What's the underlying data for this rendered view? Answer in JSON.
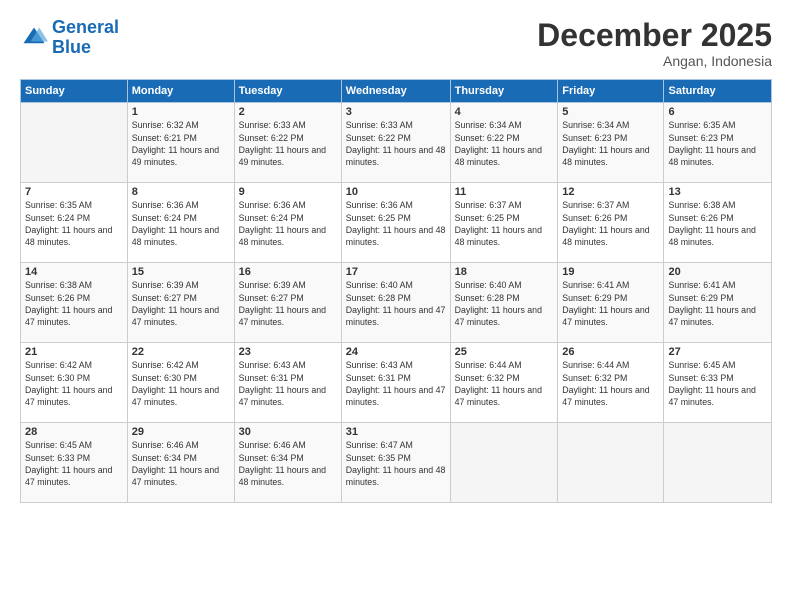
{
  "logo": {
    "line1": "General",
    "line2": "Blue"
  },
  "title": "December 2025",
  "subtitle": "Angan, Indonesia",
  "header": {
    "days": [
      "Sunday",
      "Monday",
      "Tuesday",
      "Wednesday",
      "Thursday",
      "Friday",
      "Saturday"
    ]
  },
  "weeks": [
    [
      {
        "day": "",
        "sunrise": "",
        "sunset": "",
        "daylight": ""
      },
      {
        "day": "1",
        "sunrise": "Sunrise: 6:32 AM",
        "sunset": "Sunset: 6:21 PM",
        "daylight": "Daylight: 11 hours and 49 minutes."
      },
      {
        "day": "2",
        "sunrise": "Sunrise: 6:33 AM",
        "sunset": "Sunset: 6:22 PM",
        "daylight": "Daylight: 11 hours and 49 minutes."
      },
      {
        "day": "3",
        "sunrise": "Sunrise: 6:33 AM",
        "sunset": "Sunset: 6:22 PM",
        "daylight": "Daylight: 11 hours and 48 minutes."
      },
      {
        "day": "4",
        "sunrise": "Sunrise: 6:34 AM",
        "sunset": "Sunset: 6:22 PM",
        "daylight": "Daylight: 11 hours and 48 minutes."
      },
      {
        "day": "5",
        "sunrise": "Sunrise: 6:34 AM",
        "sunset": "Sunset: 6:23 PM",
        "daylight": "Daylight: 11 hours and 48 minutes."
      },
      {
        "day": "6",
        "sunrise": "Sunrise: 6:35 AM",
        "sunset": "Sunset: 6:23 PM",
        "daylight": "Daylight: 11 hours and 48 minutes."
      }
    ],
    [
      {
        "day": "7",
        "sunrise": "Sunrise: 6:35 AM",
        "sunset": "Sunset: 6:24 PM",
        "daylight": "Daylight: 11 hours and 48 minutes."
      },
      {
        "day": "8",
        "sunrise": "Sunrise: 6:36 AM",
        "sunset": "Sunset: 6:24 PM",
        "daylight": "Daylight: 11 hours and 48 minutes."
      },
      {
        "day": "9",
        "sunrise": "Sunrise: 6:36 AM",
        "sunset": "Sunset: 6:24 PM",
        "daylight": "Daylight: 11 hours and 48 minutes."
      },
      {
        "day": "10",
        "sunrise": "Sunrise: 6:36 AM",
        "sunset": "Sunset: 6:25 PM",
        "daylight": "Daylight: 11 hours and 48 minutes."
      },
      {
        "day": "11",
        "sunrise": "Sunrise: 6:37 AM",
        "sunset": "Sunset: 6:25 PM",
        "daylight": "Daylight: 11 hours and 48 minutes."
      },
      {
        "day": "12",
        "sunrise": "Sunrise: 6:37 AM",
        "sunset": "Sunset: 6:26 PM",
        "daylight": "Daylight: 11 hours and 48 minutes."
      },
      {
        "day": "13",
        "sunrise": "Sunrise: 6:38 AM",
        "sunset": "Sunset: 6:26 PM",
        "daylight": "Daylight: 11 hours and 48 minutes."
      }
    ],
    [
      {
        "day": "14",
        "sunrise": "Sunrise: 6:38 AM",
        "sunset": "Sunset: 6:26 PM",
        "daylight": "Daylight: 11 hours and 47 minutes."
      },
      {
        "day": "15",
        "sunrise": "Sunrise: 6:39 AM",
        "sunset": "Sunset: 6:27 PM",
        "daylight": "Daylight: 11 hours and 47 minutes."
      },
      {
        "day": "16",
        "sunrise": "Sunrise: 6:39 AM",
        "sunset": "Sunset: 6:27 PM",
        "daylight": "Daylight: 11 hours and 47 minutes."
      },
      {
        "day": "17",
        "sunrise": "Sunrise: 6:40 AM",
        "sunset": "Sunset: 6:28 PM",
        "daylight": "Daylight: 11 hours and 47 minutes."
      },
      {
        "day": "18",
        "sunrise": "Sunrise: 6:40 AM",
        "sunset": "Sunset: 6:28 PM",
        "daylight": "Daylight: 11 hours and 47 minutes."
      },
      {
        "day": "19",
        "sunrise": "Sunrise: 6:41 AM",
        "sunset": "Sunset: 6:29 PM",
        "daylight": "Daylight: 11 hours and 47 minutes."
      },
      {
        "day": "20",
        "sunrise": "Sunrise: 6:41 AM",
        "sunset": "Sunset: 6:29 PM",
        "daylight": "Daylight: 11 hours and 47 minutes."
      }
    ],
    [
      {
        "day": "21",
        "sunrise": "Sunrise: 6:42 AM",
        "sunset": "Sunset: 6:30 PM",
        "daylight": "Daylight: 11 hours and 47 minutes."
      },
      {
        "day": "22",
        "sunrise": "Sunrise: 6:42 AM",
        "sunset": "Sunset: 6:30 PM",
        "daylight": "Daylight: 11 hours and 47 minutes."
      },
      {
        "day": "23",
        "sunrise": "Sunrise: 6:43 AM",
        "sunset": "Sunset: 6:31 PM",
        "daylight": "Daylight: 11 hours and 47 minutes."
      },
      {
        "day": "24",
        "sunrise": "Sunrise: 6:43 AM",
        "sunset": "Sunset: 6:31 PM",
        "daylight": "Daylight: 11 hours and 47 minutes."
      },
      {
        "day": "25",
        "sunrise": "Sunrise: 6:44 AM",
        "sunset": "Sunset: 6:32 PM",
        "daylight": "Daylight: 11 hours and 47 minutes."
      },
      {
        "day": "26",
        "sunrise": "Sunrise: 6:44 AM",
        "sunset": "Sunset: 6:32 PM",
        "daylight": "Daylight: 11 hours and 47 minutes."
      },
      {
        "day": "27",
        "sunrise": "Sunrise: 6:45 AM",
        "sunset": "Sunset: 6:33 PM",
        "daylight": "Daylight: 11 hours and 47 minutes."
      }
    ],
    [
      {
        "day": "28",
        "sunrise": "Sunrise: 6:45 AM",
        "sunset": "Sunset: 6:33 PM",
        "daylight": "Daylight: 11 hours and 47 minutes."
      },
      {
        "day": "29",
        "sunrise": "Sunrise: 6:46 AM",
        "sunset": "Sunset: 6:34 PM",
        "daylight": "Daylight: 11 hours and 47 minutes."
      },
      {
        "day": "30",
        "sunrise": "Sunrise: 6:46 AM",
        "sunset": "Sunset: 6:34 PM",
        "daylight": "Daylight: 11 hours and 48 minutes."
      },
      {
        "day": "31",
        "sunrise": "Sunrise: 6:47 AM",
        "sunset": "Sunset: 6:35 PM",
        "daylight": "Daylight: 11 hours and 48 minutes."
      },
      {
        "day": "",
        "sunrise": "",
        "sunset": "",
        "daylight": ""
      },
      {
        "day": "",
        "sunrise": "",
        "sunset": "",
        "daylight": ""
      },
      {
        "day": "",
        "sunrise": "",
        "sunset": "",
        "daylight": ""
      }
    ]
  ]
}
